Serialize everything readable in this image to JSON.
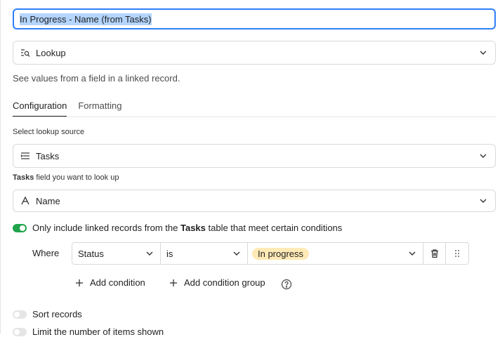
{
  "field_name": {
    "value": "In Progress - Name (from Tasks)"
  },
  "field_type": {
    "label": "Lookup",
    "icon": "lookup-icon"
  },
  "description": "See values from a field in a linked record.",
  "tabs": [
    {
      "label": "Configuration",
      "active": true
    },
    {
      "label": "Formatting",
      "active": false
    }
  ],
  "lookup_source": {
    "label": "Select lookup source",
    "value": "Tasks",
    "icon": "linked-table-icon"
  },
  "lookup_field": {
    "label_bold": "Tasks",
    "label_rest": " field you want to look up",
    "value": "Name",
    "icon": "text-field-icon"
  },
  "conditions_toggle": {
    "on": true,
    "text_before": "Only include linked records from the ",
    "text_bold": "Tasks",
    "text_after": " table that meet certain conditions"
  },
  "condition": {
    "where_label": "Where",
    "field": "Status",
    "operator": "is",
    "value": "In progress",
    "value_color": "#ffeab6"
  },
  "actions": {
    "add_condition": "Add condition",
    "add_condition_group": "Add condition group"
  },
  "sort_toggle": {
    "on": false,
    "label": "Sort records"
  },
  "limit_toggle": {
    "on": false,
    "label": "Limit the number of items shown"
  },
  "colors": {
    "accent": "#2d7ff9",
    "toggle_on": "#20a44b",
    "selection": "#b4d5fe"
  }
}
